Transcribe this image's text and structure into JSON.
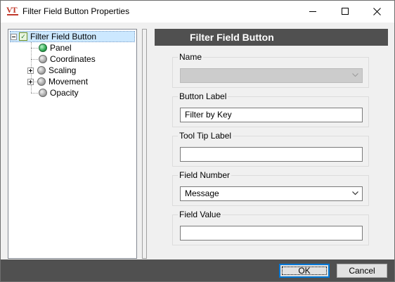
{
  "window": {
    "title": "Filter Field Button Properties",
    "app_icon_text": "VT"
  },
  "tree": {
    "root_label": "Filter Field Button",
    "items": [
      {
        "label": "Panel",
        "status": "green",
        "expandable": false
      },
      {
        "label": "Coordinates",
        "status": "gray",
        "expandable": false
      },
      {
        "label": "Scaling",
        "status": "gray",
        "expandable": true
      },
      {
        "label": "Movement",
        "status": "gray",
        "expandable": true
      },
      {
        "label": "Opacity",
        "status": "gray",
        "expandable": false
      }
    ]
  },
  "panel": {
    "header": "Filter Field Button",
    "groups": [
      {
        "label": "Name",
        "value": "",
        "type": "dropdown",
        "disabled": true
      },
      {
        "label": "Button Label",
        "value": "Filter by Key",
        "type": "text"
      },
      {
        "label": "Tool Tip Label",
        "value": "",
        "type": "text"
      },
      {
        "label": "Field Number",
        "value": "Message",
        "type": "dropdown"
      },
      {
        "label": "Field Value",
        "value": "",
        "type": "text"
      }
    ]
  },
  "buttons": {
    "ok": "OK",
    "cancel": "Cancel"
  },
  "colors": {
    "header_bg": "#505050",
    "selection_bg": "#cce8ff",
    "focus_border": "#0078d7",
    "app_icon": "#c0392b"
  }
}
